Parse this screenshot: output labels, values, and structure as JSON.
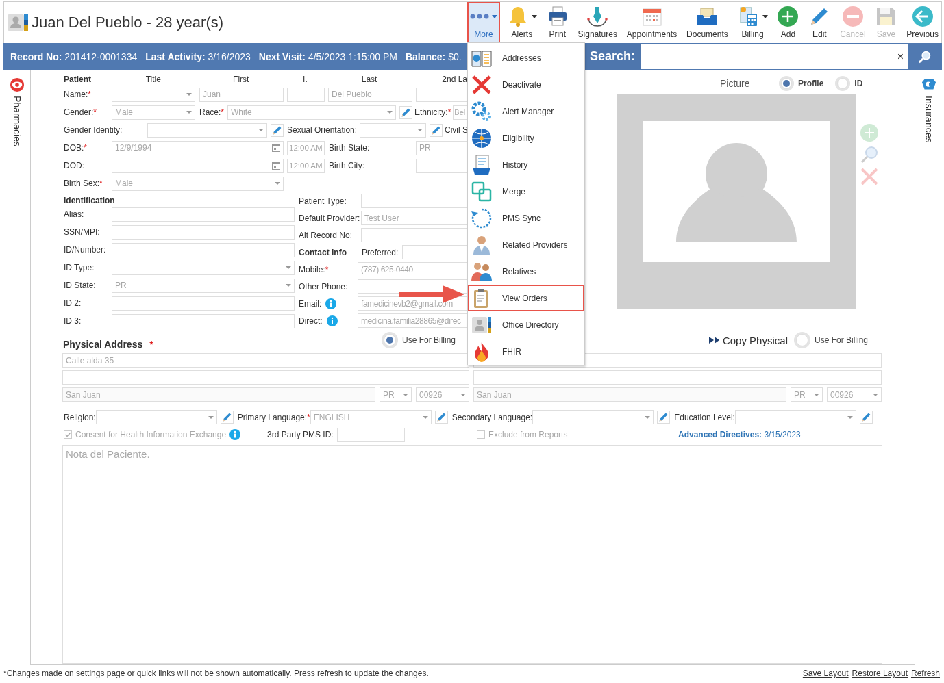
{
  "header": {
    "title": "Juan Del Pueblo - 28 year(s)"
  },
  "toolbar": [
    {
      "label": "More",
      "selected": true,
      "disabled": false,
      "dropdown": true
    },
    {
      "label": "Alerts",
      "selected": false,
      "disabled": false,
      "dropdown": true
    },
    {
      "label": "Print",
      "selected": false,
      "disabled": false,
      "dropdown": false
    },
    {
      "label": "Signatures",
      "selected": false,
      "disabled": false,
      "dropdown": false
    },
    {
      "label": "Appointments",
      "selected": false,
      "disabled": false,
      "dropdown": false
    },
    {
      "label": "Documents",
      "selected": false,
      "disabled": false,
      "dropdown": false
    },
    {
      "label": "Billing",
      "selected": false,
      "disabled": false,
      "dropdown": true
    },
    {
      "label": "Add",
      "selected": false,
      "disabled": false,
      "dropdown": false
    },
    {
      "label": "Edit",
      "selected": false,
      "disabled": false,
      "dropdown": false
    },
    {
      "label": "Cancel",
      "selected": false,
      "disabled": true,
      "dropdown": false
    },
    {
      "label": "Save",
      "selected": false,
      "disabled": true,
      "dropdown": false
    },
    {
      "label": "Previous",
      "selected": false,
      "disabled": false,
      "dropdown": false
    }
  ],
  "info_bar": [
    "**Record No:** 201412-0001334",
    "**Last Activity:** 3/16/2023",
    "**Next Visit:** 4/5/2023 1:15:00 PM",
    "**Balance:** $0."
  ],
  "search": {
    "label": "Search:",
    "clear": "×"
  },
  "more_menu": [
    {
      "label": "Addresses",
      "highlighted": false
    },
    {
      "label": "Deactivate",
      "highlighted": false
    },
    {
      "label": "Alert Manager",
      "highlighted": false
    },
    {
      "label": "Eligibility",
      "highlighted": false
    },
    {
      "label": "History",
      "highlighted": false
    },
    {
      "label": "Merge",
      "highlighted": false
    },
    {
      "label": "PMS Sync",
      "highlighted": false
    },
    {
      "label": "Related Providers",
      "highlighted": false
    },
    {
      "label": "Relatives",
      "highlighted": false
    },
    {
      "label": "View Orders",
      "highlighted": true
    },
    {
      "label": "Office Directory",
      "highlighted": false
    },
    {
      "label": "FHIR",
      "highlighted": false
    }
  ],
  "side_tabs": {
    "left": "Pharmacies",
    "right": "Insurances"
  },
  "patient": {
    "heading": "Patient",
    "name_headers": [
      "Title",
      "First",
      "I.",
      "Last",
      "2nd La"
    ],
    "name": {
      "label": "Name:",
      "mark": "*",
      "first": "Juan",
      "last": "Del Pueblo"
    },
    "gender": {
      "label": "Gender:",
      "mark": "*",
      "value": "Male"
    },
    "race": {
      "label": "Race:",
      "mark": "*",
      "value": "White"
    },
    "ethnicity": {
      "label": "Ethnicity:",
      "mark": "*",
      "value": "Bel"
    },
    "gender_identity": {
      "label": "Gender Identity:"
    },
    "sexual_orientation": {
      "label": "Sexual Orientation:"
    },
    "civil_status": {
      "label": "Civil S"
    },
    "dob": {
      "label": "DOB:",
      "mark": "*",
      "value": "12/9/1994",
      "time": "12:00 AM"
    },
    "birth_state": {
      "label": "Birth State:",
      "value": "PR"
    },
    "dod": {
      "label": "DOD:",
      "time": "12:00 AM"
    },
    "birth_city": {
      "label": "Birth City:"
    },
    "birth_sex": {
      "label": "Birth Sex:",
      "mark": "*",
      "value": "Male"
    }
  },
  "identification": {
    "heading": "Identification",
    "fields": [
      {
        "label": "Alias:",
        "kind": "text"
      },
      {
        "label": "SSN/MPI:",
        "kind": "text"
      },
      {
        "label": "ID/Number:",
        "kind": "text"
      },
      {
        "label": "ID Type:",
        "kind": "dropdown"
      },
      {
        "label": "ID State:",
        "kind": "dropdown",
        "value": "PR"
      },
      {
        "label": "ID 2:",
        "kind": "text"
      },
      {
        "label": "ID 3:",
        "kind": "text"
      }
    ]
  },
  "other": [
    {
      "label": "Patient Type:"
    },
    {
      "label": "Default Provider:",
      "value": "Test User"
    },
    {
      "label": "Alt Record No:"
    }
  ],
  "contact": {
    "heading": "Contact Info",
    "preferred": "Preferred:",
    "fields": [
      {
        "label": "Mobile:",
        "mark": "*",
        "info": false,
        "value": "(787) 625-0440"
      },
      {
        "label": "Other Phone:",
        "info": false
      },
      {
        "label": "Email:",
        "info": true,
        "value": "famedicinevb2@gmail.com"
      },
      {
        "label": "Direct:",
        "info": true,
        "value": "medicina.familia28865@direc"
      }
    ]
  },
  "picture": {
    "heading": "Picture",
    "options": [
      {
        "label": "Profile",
        "selected": true
      },
      {
        "label": "ID",
        "selected": false
      }
    ]
  },
  "physical": {
    "heading": "Physical Address",
    "mark": "*",
    "use_for_billing": {
      "label": "Use For Billing",
      "selected": true
    },
    "line1": "Calle alda 35",
    "city": "San Juan",
    "state": "PR",
    "zip": "00926"
  },
  "mailing": {
    "copy": "Copy Physical",
    "use_for_billing": {
      "label": "Use For Billing",
      "selected": false
    },
    "city": "San Juan",
    "state": "PR",
    "zip": "00926"
  },
  "demographics": [
    {
      "label": "Religion:"
    },
    {
      "label": "Primary Language:",
      "mark": "*",
      "value": "ENGLISH"
    },
    {
      "label": "Secondary Language:"
    },
    {
      "label": "Education Level:"
    }
  ],
  "consent": {
    "label": "Consent for Health Information Exchange",
    "checked": true
  },
  "pms": {
    "label": "3rd Party PMS ID:"
  },
  "exclude": {
    "label": "Exclude from Reports",
    "checked": false
  },
  "advanced_directives": "**Advanced Directives:** 3/15/2023",
  "notes": {
    "placeholder": "Nota del Paciente."
  },
  "footer": {
    "note": "*Changes made on settings page or quick links will not be shown automatically. Press refresh to update the changes.",
    "links": [
      "Save Layout",
      "Restore Layout",
      "Refresh"
    ]
  }
}
